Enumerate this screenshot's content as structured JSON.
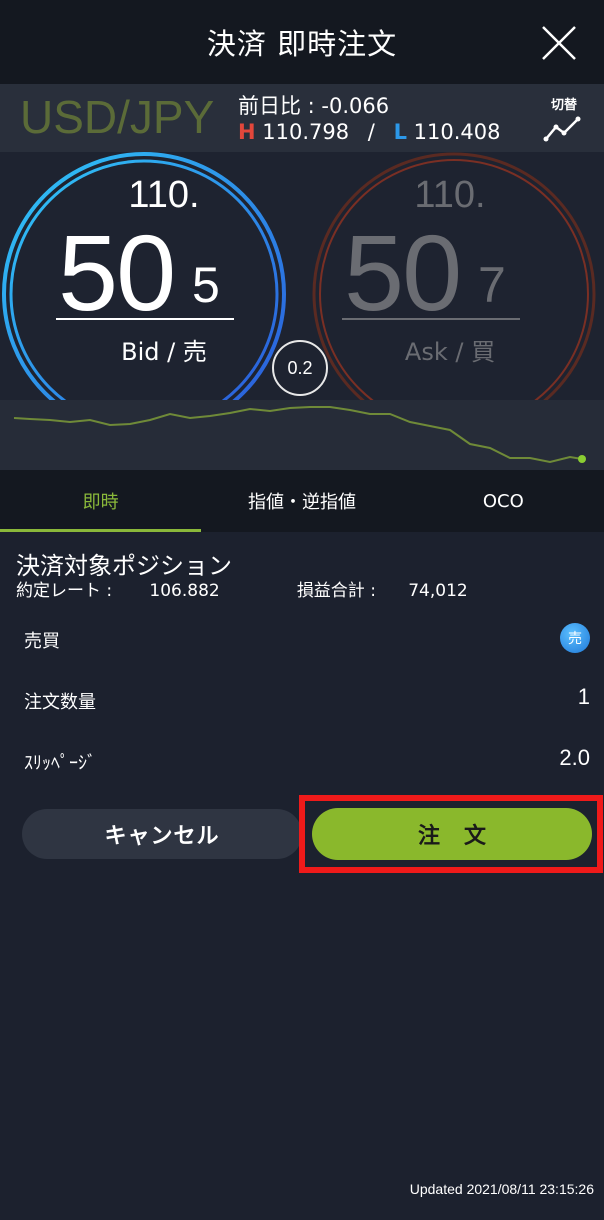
{
  "header": {
    "title": "決済 即時注文"
  },
  "info": {
    "pair": "USD/JPY",
    "prev_diff": "前日比 : -0.066",
    "high_label": "H",
    "high_value": "110.798",
    "separator": "/",
    "low_label": "L",
    "low_value": "110.408",
    "switch_label": "切替"
  },
  "quote": {
    "bid": {
      "prefix": "110.",
      "big": "50",
      "pip": "5",
      "label": "Bid / 売"
    },
    "ask": {
      "prefix": "110.",
      "big": "50",
      "pip": "7",
      "label": "Ask / 買"
    },
    "spread": "0.2"
  },
  "tabs": [
    {
      "label": "即時"
    },
    {
      "label": "指値・逆指値"
    },
    {
      "label": "OCO"
    }
  ],
  "position": {
    "title": "決済対象ポジション",
    "rate_label": "約定レート :",
    "rate_value": "106.882",
    "pl_label": "損益合計 :",
    "pl_value": "74,012"
  },
  "form": {
    "side_label": "売買",
    "side_badge": "売",
    "qty_label": "注文数量",
    "qty_value": "1",
    "slip_label": "ｽﾘｯﾍﾟｰｼﾞ",
    "slip_value": "2.0"
  },
  "buttons": {
    "cancel": "キャンセル",
    "order": "注文"
  },
  "footer": {
    "updated": "Updated  2021/08/11 23:15:26"
  },
  "colors": {
    "accent": "#8ab83a",
    "bid_ring": "#2a8fe8",
    "ask_ring": "#7a2f24",
    "highlight": "#ef1a1a"
  }
}
